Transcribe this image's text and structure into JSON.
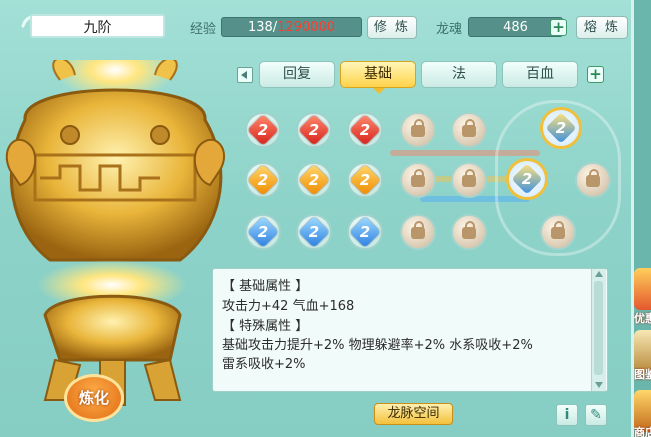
{
  "header": {
    "title": "九阶",
    "exp_label": "经验",
    "exp_current": "138/",
    "exp_required": "1290000",
    "cultivate_button": "修 炼",
    "soul_label": "龙魂",
    "soul_value": "486",
    "smelt_button": "熔 炼"
  },
  "tabs": [
    {
      "label": "回复",
      "active": false
    },
    {
      "label": "基础",
      "active": true
    },
    {
      "label": "法",
      "active": false
    },
    {
      "label": "百血",
      "active": false
    }
  ],
  "gems": {
    "rows": [
      {
        "color": "red",
        "slots": [
          "filled",
          "filled",
          "filled",
          "locked",
          "locked"
        ]
      },
      {
        "color": "orange",
        "slots": [
          "filled",
          "filled",
          "filled",
          "locked",
          "locked"
        ]
      },
      {
        "color": "blue",
        "slots": [
          "filled",
          "filled",
          "filled",
          "locked",
          "locked"
        ]
      }
    ],
    "special_slots": [
      "unlocked",
      "unlocked",
      "locked",
      "locked"
    ]
  },
  "info": {
    "basic_header": "【 基础属性 】",
    "basic_stats": "攻击力+42  气血+168",
    "special_header": "【 特殊属性 】",
    "special_line1": "基础攻击力提升+2%  物理躲避率+2%  水系吸收+2%",
    "special_line2": "雷系吸收+2%"
  },
  "footer": {
    "dragon_vein_button": "龙脉空间",
    "refine_button": "炼化"
  },
  "side_strip": {
    "item1": "优惠",
    "item2": "图鉴",
    "item3": "商店"
  },
  "colors": {
    "panel_bg": "#8ed3c9",
    "accent_gold": "#ffd34a",
    "exp_required_red": "#ff3b2f"
  }
}
